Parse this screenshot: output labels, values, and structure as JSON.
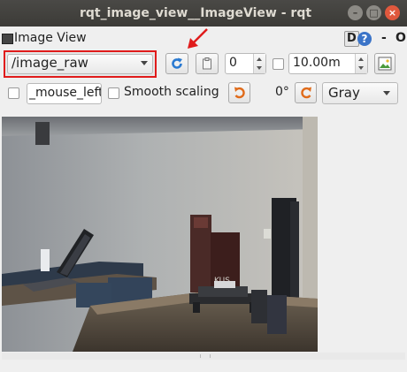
{
  "window": {
    "title": "rqt_image_view__ImageView - rqt",
    "minimize_glyph": "–",
    "maximize_glyph": "□",
    "close_glyph": "×"
  },
  "dock": {
    "title": "Image View",
    "d_label": "D",
    "help_label": "?",
    "dash_label": "-",
    "o_label": "O"
  },
  "toolbar": {
    "topic": "/image_raw",
    "refresh_icon": "refresh-icon",
    "refresh_color": "#2a7ad1",
    "copy_icon": "clipboard-icon",
    "spin_number": "0",
    "range_value": "10.00m",
    "save_icon": "save-image-icon"
  },
  "controls": {
    "mouse_topic": "_mouse_left",
    "smooth_scaling_label": "Smooth scaling",
    "rotate_left_icon": "rotate-ccw-icon",
    "rotation": "0°",
    "rotate_right_icon": "rotate-cw-icon",
    "rotate_color": "#e06b1a",
    "color_scheme": "Gray"
  },
  "image": {
    "icon": "camera-feed-image",
    "brand_text": "KUS"
  },
  "colors": {
    "highlight_red": "#e01b1b",
    "titlebar": "#3c3b37"
  }
}
